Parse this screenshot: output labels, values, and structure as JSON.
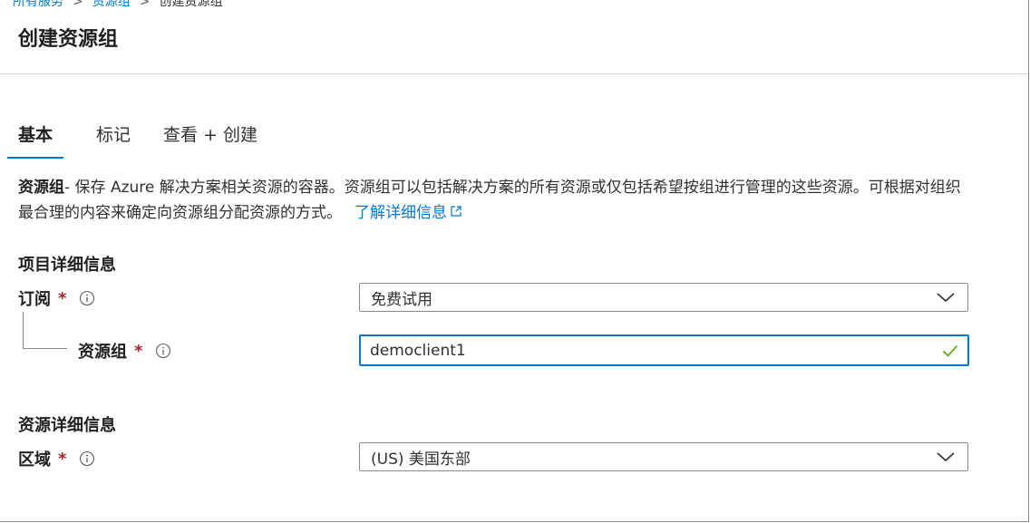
{
  "breadcrumb": {
    "items": [
      "所有服务",
      "资源组"
    ],
    "current": "创建资源组",
    "separator": ">"
  },
  "page": {
    "title": "创建资源组"
  },
  "tabs": [
    {
      "label": "基本",
      "active": true
    },
    {
      "label": "标记",
      "active": false
    },
    {
      "label": "查看 + 创建",
      "active": false
    }
  ],
  "description": {
    "term": "资源组",
    "text": "- 保存 Azure 解决方案相关资源的容器。资源组可以包括解决方案的所有资源或仅包括希望按组进行管理的这些资源。可根据对组织最合理的内容来确定向资源组分配资源的方式。",
    "link": "了解详细信息"
  },
  "project_details": {
    "heading": "项目详细信息",
    "subscription": {
      "label": "订阅",
      "required_marker": "*",
      "value": "免费试用"
    },
    "resource_group": {
      "label": "资源组",
      "required_marker": "*",
      "value": "democlient1"
    }
  },
  "resource_details": {
    "heading": "资源详细信息",
    "region": {
      "label": "区域",
      "required_marker": "*",
      "value": "(US) 美国东部"
    }
  },
  "colors": {
    "accent": "#0078d4",
    "required": "#a4262c",
    "valid": "#57a300"
  },
  "icons": {
    "info": "info-icon",
    "dropdown": "chevron-down-icon",
    "external_link": "external-link-icon",
    "valid": "checkmark-icon"
  }
}
